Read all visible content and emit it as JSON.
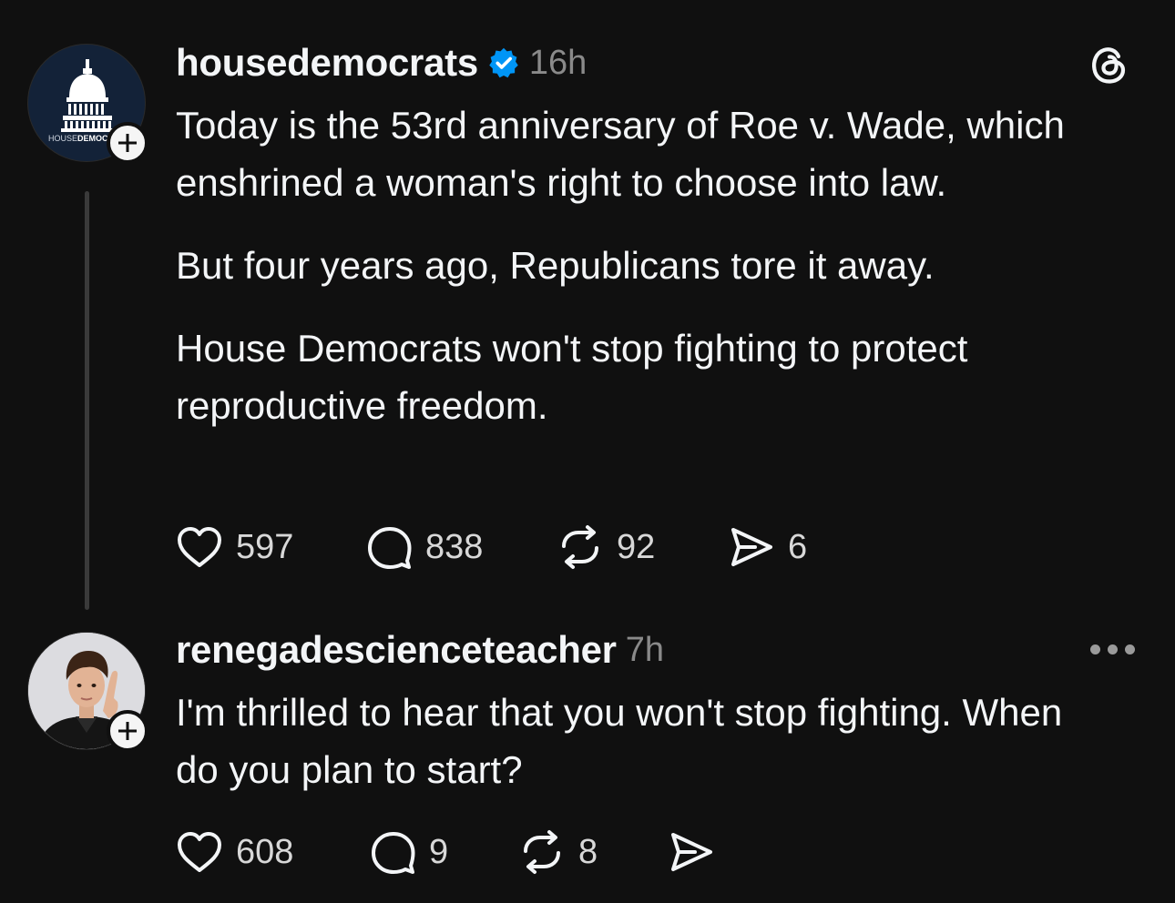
{
  "colors": {
    "background": "#101010",
    "text_primary": "#f3f5f7",
    "text_secondary": "#8a8a8a",
    "verified_blue": "#0095f6"
  },
  "post": {
    "avatar_text": "HOUSE DEMOCRATS",
    "avatar_icon": "capitol-dome-icon",
    "username": "housedemocrats",
    "verified": true,
    "timestamp": "16h",
    "paragraphs": [
      "Today is the 53rd anniversary of Roe v. Wade, which enshrined a woman's right to choose into law.",
      "But four years ago, Republicans tore it away.",
      "House Democrats won't stop fighting to protect reproductive freedom."
    ],
    "likes": "597",
    "replies": "838",
    "reposts": "92",
    "shares": "6",
    "app_icon": "threads-logo-icon"
  },
  "reply": {
    "username": "renegadescienceteacher",
    "timestamp": "7h",
    "paragraphs": [
      "I'm thrilled to hear that you won't stop fighting. When do you plan to start?"
    ],
    "likes": "608",
    "replies": "9",
    "reposts": "8",
    "shares": ""
  }
}
